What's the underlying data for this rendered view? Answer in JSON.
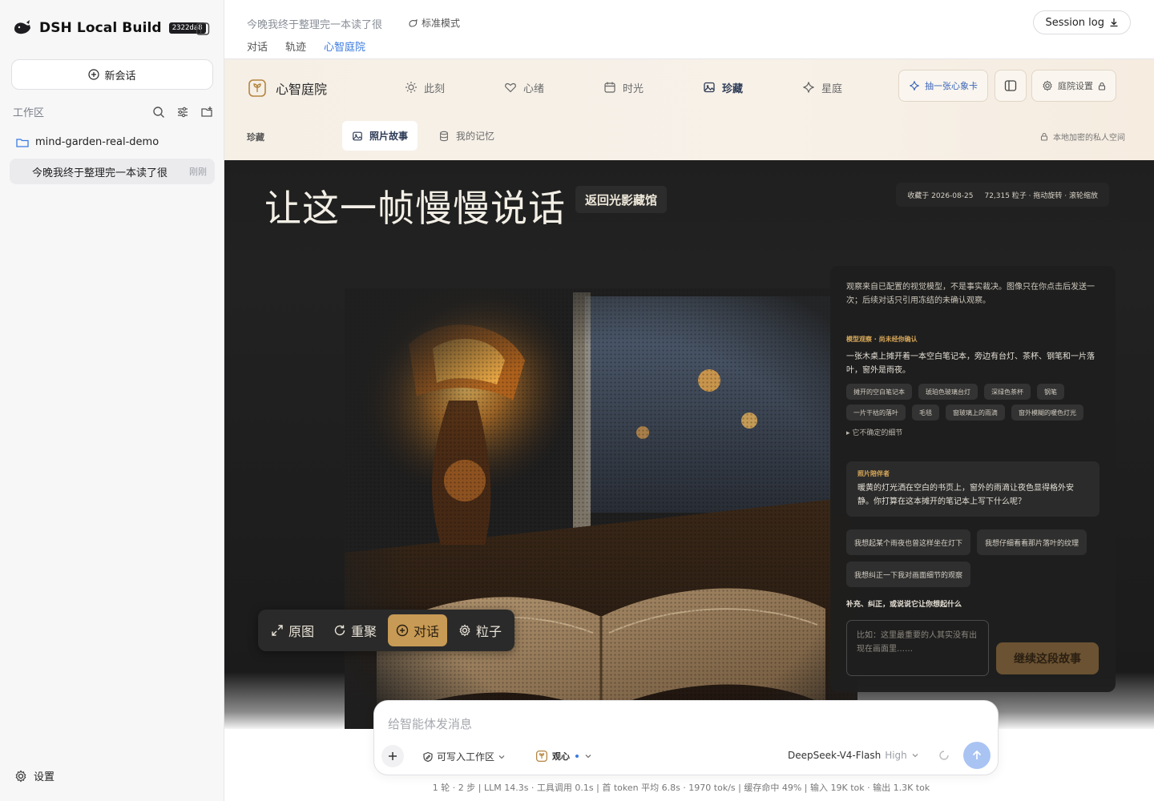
{
  "sidebar": {
    "app_name": "DSH Local Build",
    "build_badge": "2322da8",
    "new_chat": "新会话",
    "workspace_label": "工作区",
    "folder_name": "mind-garden-real-demo",
    "chat_title": "今晚我终于整理完一本读了很",
    "chat_time": "刚刚",
    "settings": "设置"
  },
  "header": {
    "conversation_title": "今晚我终于整理完一本读了很",
    "mode": "标准模式",
    "tabs": [
      "对话",
      "轨迹",
      "心智庭院"
    ],
    "active_tab": "心智庭院",
    "session_log": "Session log"
  },
  "garden": {
    "brand": "心智庭院",
    "nav": [
      "此刻",
      "心绪",
      "时光",
      "珍藏",
      "星庭"
    ],
    "active_nav": "珍藏",
    "draw_card": "抽一张心象卡",
    "garden_settings": "庭院设置",
    "section_label": "珍藏",
    "sub_tabs": [
      "照片故事",
      "我的记忆"
    ],
    "private_note": "本地加密的私人空间"
  },
  "stage": {
    "title": "让这一帧慢慢说话",
    "back_button": "返回光影藏馆",
    "collected_on": "收藏于 2026-08-25",
    "particles": "72,315 粒子 · 拖动旋转 · 滚轮缩放",
    "toolbar": [
      "原图",
      "重聚",
      "对话",
      "粒子"
    ],
    "active_tool": "对话"
  },
  "panel": {
    "note": "观察来自已配置的视觉模型，不是事实裁决。图像只在你点击后发送一次；后续对话只引用冻结的未确认观察。",
    "tag_head": "模型观察 · 尚未经你确认",
    "observation": "一张木桌上摊开着一本空白笔记本，旁边有台灯、茶杯、钢笔和一片落叶，窗外是雨夜。",
    "chips": [
      "摊开的空白笔记本",
      "琥珀色玻璃台灯",
      "深绿色茶杯",
      "钢笔",
      "一片干枯的落叶",
      "毛毯",
      "窗玻璃上的雨滴",
      "窗外模糊的暖色灯光"
    ],
    "unsure": "▸ 它不确定的细节",
    "companion_head": "照片陪伴者",
    "companion_body": "暖黄的灯光洒在空白的书页上，窗外的雨滴让夜色显得格外安静。你打算在这本摊开的笔记本上写下什么呢？",
    "suggestions": [
      "我想起某个雨夜也曾这样坐在灯下",
      "我想仔细看看那片落叶的纹理",
      "我想纠正一下我对画面细节的观察"
    ],
    "add_label": "补充、纠正，或说说它让你想起什么",
    "textarea_placeholder": "比如：这里最重要的人其实没有出现在画面里……",
    "continue": "继续这段故事"
  },
  "composer": {
    "placeholder": "给智能体发消息",
    "permission": "可写入工作区",
    "persona": "观心",
    "model": "DeepSeek-V4-Flash",
    "level": "High"
  },
  "stats": "1 轮 · 2 步  |  LLM 14.3s · 工具调用 0.1s  |  首 token 平均 6.8s · 1970 tok/s  |  缓存命中 49%  |  输入 19K tok · 输出 1.3K tok",
  "colors": {
    "accent_blue": "#3a7be0",
    "amber": "#c79a55",
    "stage_bg": "#1f1f1f",
    "garden_bg": "#f5efe6"
  }
}
